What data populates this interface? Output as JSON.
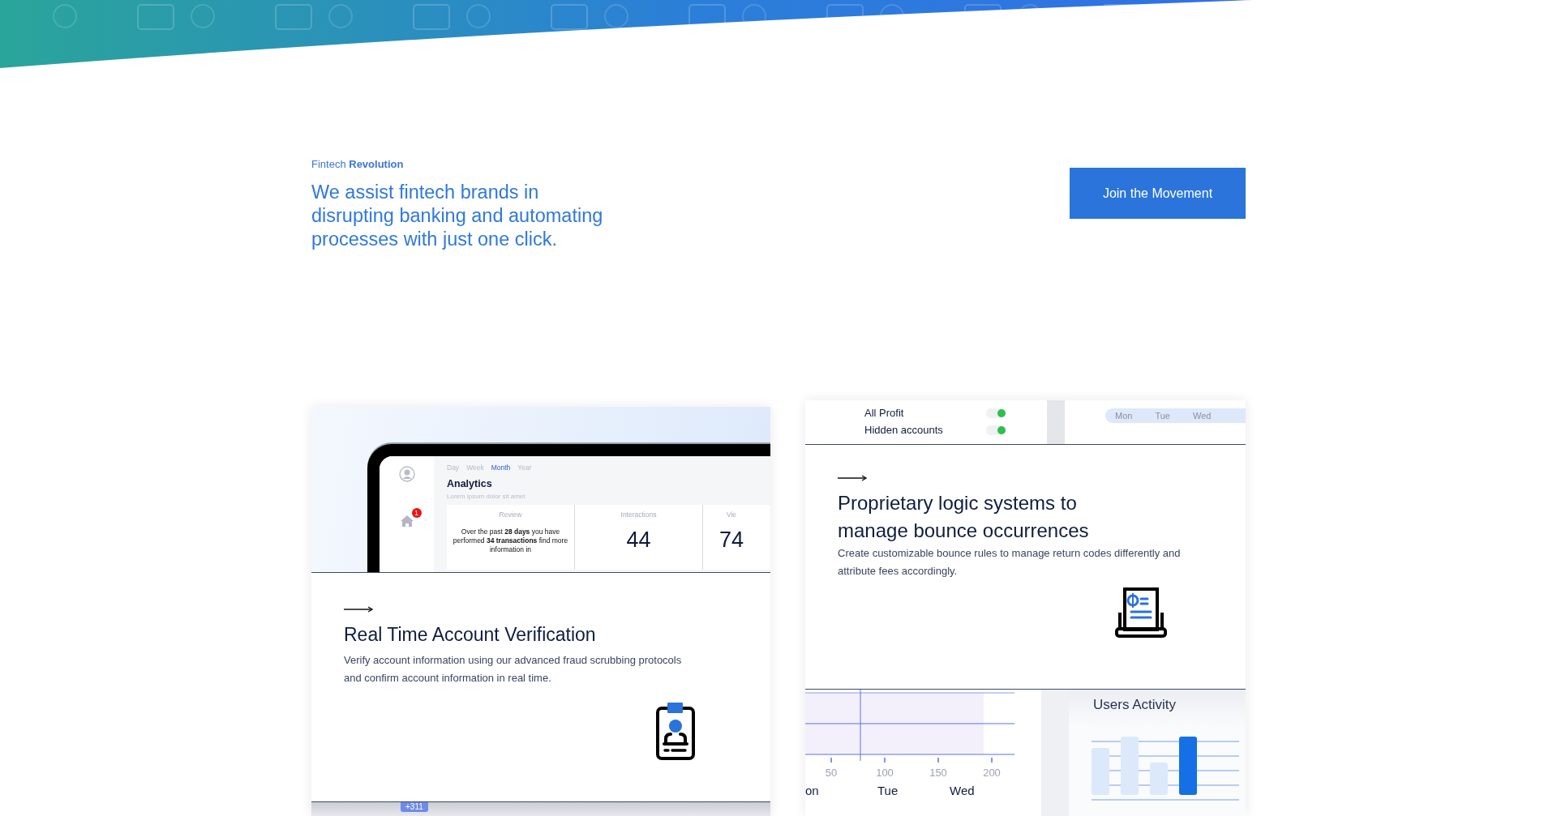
{
  "hero": {
    "eyebrow": "Fintech **Revolution**",
    "headline": "We assist fintech brands in disrupting banking and automating processes with just one click.",
    "button": "Join the Movement"
  },
  "cards": [
    {
      "kind": "analytics",
      "mockup": {
        "tabs": [
          {
            "label": "Day",
            "selected": false
          },
          {
            "label": "Week",
            "selected": false
          },
          {
            "label": "Month",
            "selected": true
          },
          {
            "label": "Year",
            "selected": false
          }
        ],
        "title": "Analytics",
        "subtitle": "Lorem ipsum dolor sit amet",
        "notification_badge": "1",
        "columns": [
          {
            "label": "Review",
            "text": "Over the past **28 days** you have performed **34 transactions** find more information in"
          },
          {
            "label": "Interactions",
            "value": "44"
          },
          {
            "label": "Vie",
            "value": "74"
          }
        ]
      },
      "title": "Real Time Account Verification",
      "description": "Verify account information using our advanced fraud scrubbing protocols and confirm account information in real time.",
      "footer_badge": "+311"
    },
    {
      "kind": "bounce",
      "mockup": {
        "toggles": [
          {
            "label": "All Profit",
            "on": true
          },
          {
            "label": "Hidden accounts",
            "on": true
          }
        ],
        "days": [
          "Mon",
          "Tue",
          "Wed"
        ]
      },
      "title": "Proprietary logic systems to manage bounce occurrences",
      "description": "Create customizable bounce rules to manage return codes differently and attribute fees accordingly.",
      "chart": {
        "ticks": [
          "50",
          "100",
          "150",
          "200"
        ],
        "days": [
          "on",
          "Tue",
          "Wed"
        ],
        "activity_title": "Users Activity"
      }
    }
  ]
}
